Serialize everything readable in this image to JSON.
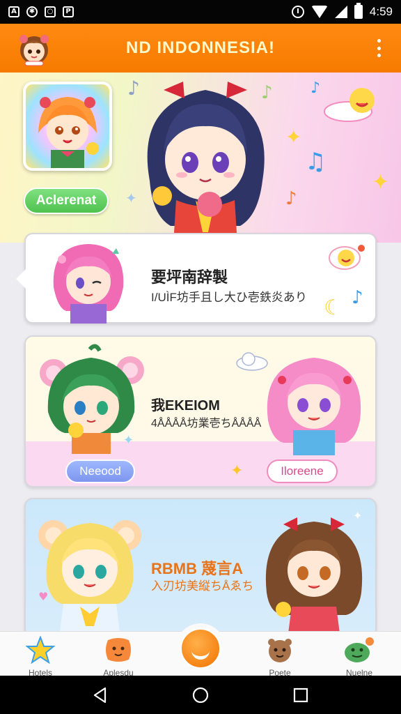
{
  "status_bar": {
    "time": "4:59",
    "left_icons": [
      "notification-icon",
      "settings-icon",
      "clock-app-icon",
      "parking-icon"
    ]
  },
  "app_bar": {
    "title": "ND INDONNESIA!",
    "menu_icon": "more-vert-icon"
  },
  "hero": {
    "button_label": "Aclerenat"
  },
  "cards": [
    {
      "title": "要坪南辞製",
      "subtitle": "I/UÌF坊手且し大ひ壱鉄炎あり"
    },
    {
      "title": "我EKEIOM",
      "subtitle": "4ÅÅÅÅ坊業壱ちÅÅÅÅ",
      "left_button": "Neeood",
      "right_button": "Iloreene"
    },
    {
      "title": "RBMB 蔑言A",
      "subtitle": "入刃坊美縦ちÅゑち"
    }
  ],
  "bottom_nav": {
    "items": [
      "Hotels",
      "Aplesdu",
      "Poete",
      "Nuelne"
    ]
  },
  "colors": {
    "accent": "#f77a00",
    "status_bar": "#050505",
    "green_button": "#4ec24e",
    "blue_pill": "#7d96ee",
    "pink_pill": "#d9488c"
  }
}
